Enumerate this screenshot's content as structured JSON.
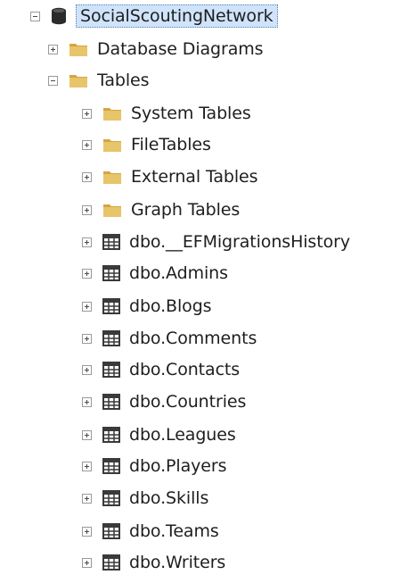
{
  "tree": {
    "root": {
      "label": "SocialScoutingNetwork",
      "icon": "database-icon",
      "expanded": true,
      "selected": true
    },
    "database_diagrams": {
      "label": "Database Diagrams",
      "icon": "folder-icon",
      "expanded": false
    },
    "tables": {
      "label": "Tables",
      "icon": "folder-icon",
      "expanded": true,
      "children": [
        {
          "label": "System Tables",
          "icon": "folder-icon",
          "expanded": false
        },
        {
          "label": "FileTables",
          "icon": "folder-icon",
          "expanded": false
        },
        {
          "label": "External Tables",
          "icon": "folder-icon",
          "expanded": false
        },
        {
          "label": "Graph Tables",
          "icon": "folder-icon",
          "expanded": false
        },
        {
          "label": "dbo.__EFMigrationsHistory",
          "icon": "table-icon",
          "expanded": false
        },
        {
          "label": "dbo.Admins",
          "icon": "table-icon",
          "expanded": false
        },
        {
          "label": "dbo.Blogs",
          "icon": "table-icon",
          "expanded": false
        },
        {
          "label": "dbo.Comments",
          "icon": "table-icon",
          "expanded": false
        },
        {
          "label": "dbo.Contacts",
          "icon": "table-icon",
          "expanded": false
        },
        {
          "label": "dbo.Countries",
          "icon": "table-icon",
          "expanded": false
        },
        {
          "label": "dbo.Leagues",
          "icon": "table-icon",
          "expanded": false
        },
        {
          "label": "dbo.Players",
          "icon": "table-icon",
          "expanded": false
        },
        {
          "label": "dbo.Skills",
          "icon": "table-icon",
          "expanded": false
        },
        {
          "label": "dbo.Teams",
          "icon": "table-icon",
          "expanded": false
        },
        {
          "label": "dbo.Writers",
          "icon": "table-icon",
          "expanded": false
        }
      ]
    }
  },
  "colors": {
    "folder": "#e8c46a",
    "folder_dark": "#d4a53e",
    "selection": "#cfe4fb",
    "database": "#2b2b2b",
    "table_grid": "#3a3a3a"
  }
}
